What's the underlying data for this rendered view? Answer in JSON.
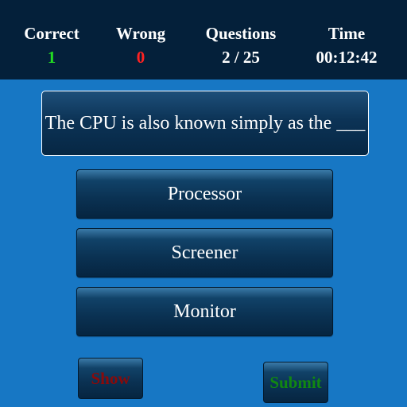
{
  "header": {
    "correct": {
      "label": "Correct",
      "value": "1",
      "color": "#22dd22"
    },
    "wrong": {
      "label": "Wrong",
      "value": "0",
      "color": "#ff2222"
    },
    "questions": {
      "label": "Questions",
      "value": "2 / 25"
    },
    "time": {
      "label": "Time",
      "value": "00:12:42"
    }
  },
  "question": {
    "text": "The CPU is also known simply as the ___"
  },
  "answers": [
    {
      "label": "Processor"
    },
    {
      "label": "Screener"
    },
    {
      "label": "Monitor"
    }
  ],
  "actions": {
    "show": {
      "label": "Show",
      "color": "#8a0a0a"
    },
    "submit": {
      "label": "Submit",
      "color": "#118811"
    }
  }
}
